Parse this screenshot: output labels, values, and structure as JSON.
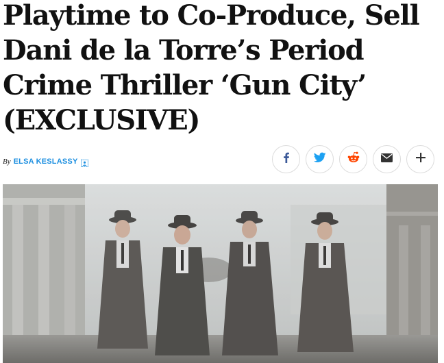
{
  "headline": "Playtime to Co-Produce, Sell Dani de la Torre’s Period Crime Thriller ‘Gun City’ (EXCLUSIVE)",
  "byline": {
    "prefix": "By",
    "author": "ELSA KESLASSY"
  },
  "share": {
    "buttons": [
      {
        "name": "facebook",
        "icon": "facebook-icon",
        "color": "#3b5998"
      },
      {
        "name": "twitter",
        "icon": "twitter-icon",
        "color": "#1da1f2"
      },
      {
        "name": "reddit",
        "icon": "reddit-icon",
        "color": "#ff4500"
      },
      {
        "name": "email",
        "icon": "email-icon",
        "color": "#333333"
      },
      {
        "name": "more",
        "icon": "plus-icon",
        "color": "#333333"
      }
    ]
  },
  "colors": {
    "author_link": "#1c8fe0",
    "headline": "#111111"
  }
}
